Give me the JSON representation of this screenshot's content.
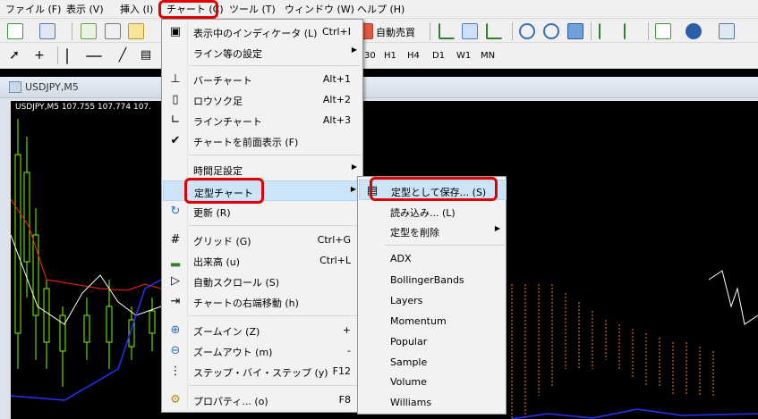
{
  "menubar": {
    "items": [
      "ファイル (F)",
      "表示 (V)",
      "挿入 (I)",
      "チャート (C)",
      "ツール (T)",
      "ウィンドウ (W)",
      "ヘルプ (H)"
    ]
  },
  "toolbar": {
    "auto_trade": "自動売買",
    "timeframes": [
      "30",
      "H1",
      "H4",
      "D1",
      "W1",
      "MN"
    ]
  },
  "chart_window": {
    "title": "USDJPY,M5",
    "info": "USDJPY,M5  107.755 107.774 107."
  },
  "chart_menu": {
    "items": [
      {
        "label": "表示中のインディケータ (L)",
        "shortcut": "Ctrl+I"
      },
      {
        "label": "ライン等の設定",
        "shortcut": ""
      },
      {
        "label": "バーチャート",
        "shortcut": "Alt+1"
      },
      {
        "label": "ロウソク足",
        "shortcut": "Alt+2"
      },
      {
        "label": "ラインチャート",
        "shortcut": "Alt+3"
      },
      {
        "label": "チャートを前面表示 (F)",
        "shortcut": ""
      },
      {
        "label": "時間足設定",
        "shortcut": ""
      },
      {
        "label": "定型チャート",
        "shortcut": ""
      },
      {
        "label": "更新 (R)",
        "shortcut": ""
      },
      {
        "label": "グリッド (G)",
        "shortcut": "Ctrl+G"
      },
      {
        "label": "出来高 (u)",
        "shortcut": "Ctrl+L"
      },
      {
        "label": "自動スクロール (S)",
        "shortcut": ""
      },
      {
        "label": "チャートの右端移動 (h)",
        "shortcut": ""
      },
      {
        "label": "ズームイン (Z)",
        "shortcut": "+"
      },
      {
        "label": "ズームアウト (m)",
        "shortcut": "-"
      },
      {
        "label": "ステップ・バイ・ステップ (y)",
        "shortcut": "F12"
      },
      {
        "label": "プロパティ... (o)",
        "shortcut": "F8"
      }
    ]
  },
  "template_menu": {
    "items": [
      "定型として保存... (S)",
      "読み込み... (L)",
      "定型を削除",
      "ADX",
      "BollingerBands",
      "Layers",
      "Momentum",
      "Popular",
      "Sample",
      "Volume",
      "Williams"
    ]
  }
}
